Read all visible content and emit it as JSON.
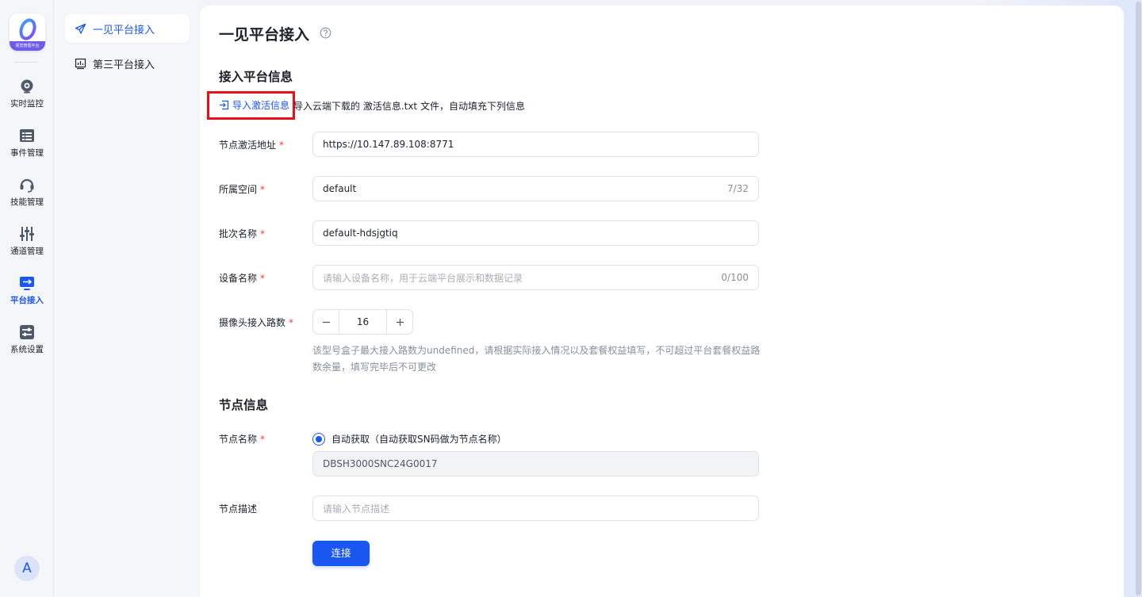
{
  "rail": {
    "logo_text": "视觉管理平台",
    "items": [
      {
        "label": "实时监控",
        "icon": "camera-icon"
      },
      {
        "label": "事件管理",
        "icon": "list-icon"
      },
      {
        "label": "技能管理",
        "icon": "headset-icon"
      },
      {
        "label": "通道管理",
        "icon": "sliders-icon"
      },
      {
        "label": "平台接入",
        "icon": "monitor-arrow-icon"
      },
      {
        "label": "系统设置",
        "icon": "settings-panel-icon"
      }
    ],
    "active_index": 4,
    "avatar_letter": "A"
  },
  "subnav": {
    "items": [
      {
        "label": "一见平台接入",
        "icon": "send-icon"
      },
      {
        "label": "第三平台接入",
        "icon": "chart-icon"
      }
    ],
    "active_index": 0
  },
  "page": {
    "title": "一见平台接入",
    "section1_title": "接入平台信息",
    "import_link": "导入激活信息",
    "import_desc": "导入云端下载的 激活信息.txt 文件，自动填充下列信息",
    "section2_title": "节点信息",
    "submit_label": "连接"
  },
  "form": {
    "activation_address": {
      "label": "节点激活地址",
      "value": "https://10.147.89.108:8771"
    },
    "space": {
      "label": "所属空间",
      "value": "default",
      "count": "7/32"
    },
    "batch_name": {
      "label": "批次名称",
      "value": "default-hdsjgtiq"
    },
    "device_name": {
      "label": "设备名称",
      "placeholder": "请输入设备名称，用于云端平台展示和数据记录",
      "count": "0/100"
    },
    "camera_channels": {
      "label": "摄像头接入路数",
      "value": "16",
      "hint": "该型号盒子最大接入路数为undefined，请根据实际接入情况以及套餐权益填写，不可超过平台套餐权益路数余量，填写完毕后不可更改"
    },
    "node_name": {
      "label": "节点名称",
      "radio_label": "自动获取（自动获取SN码做为节点名称）",
      "value": "DBSH3000SNC24G0017"
    },
    "node_desc": {
      "label": "节点描述",
      "placeholder": "请输入节点描述"
    }
  },
  "colors": {
    "accent": "#1a56f0",
    "required": "#f53f3f",
    "highlight": "#e8101a"
  }
}
